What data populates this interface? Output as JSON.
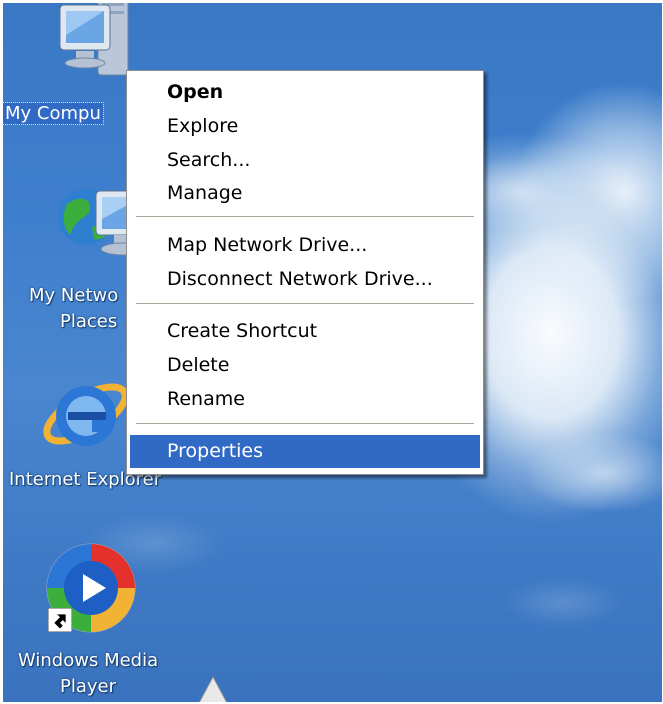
{
  "desktop": {
    "icons": [
      {
        "label_line1": "My Compu",
        "label_line2": "",
        "selected": true
      },
      {
        "label_line1": "My Netwo",
        "label_line2": "Places"
      },
      {
        "label_line1": "Internet Explorer",
        "label_line2": ""
      },
      {
        "label_line1": "Windows Media",
        "label_line2": "Player"
      }
    ]
  },
  "context_menu": {
    "items": [
      {
        "label": "Open",
        "bold": true
      },
      {
        "label": "Explore"
      },
      {
        "label": "Search..."
      },
      {
        "label": "Manage"
      },
      {
        "label": "Map Network Drive..."
      },
      {
        "label": "Disconnect Network Drive..."
      },
      {
        "label": "Create Shortcut"
      },
      {
        "label": "Delete"
      },
      {
        "label": "Rename"
      },
      {
        "label": "Properties",
        "highlighted": true
      }
    ]
  },
  "colors": {
    "menu_highlight": "#316ac5",
    "desktop_sky": "#3e7fcd"
  }
}
